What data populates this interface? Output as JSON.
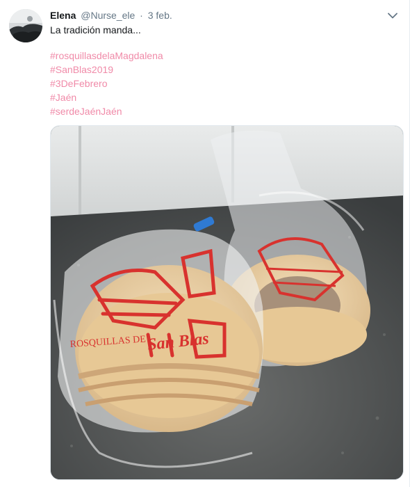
{
  "tweet": {
    "author_name": "Elena",
    "author_handle": "@Nurse_ele",
    "separator": "·",
    "date": "3 feb.",
    "text": "La tradición manda...",
    "hashtags": [
      "#rosquillasdelaMagdalena",
      "#SanBlas2019",
      "#3DeFebrero",
      "#Jaén",
      "#serdeJaénJaén"
    ],
    "caret_icon": "chevron-down-icon",
    "avatar_icon": "avatar-photo",
    "photo": {
      "bag_print_text": "ROSQUILLAS DE",
      "bag_print_script": "San Blas",
      "accent_color": "#f08aa8",
      "print_color": "#d8322e"
    }
  }
}
